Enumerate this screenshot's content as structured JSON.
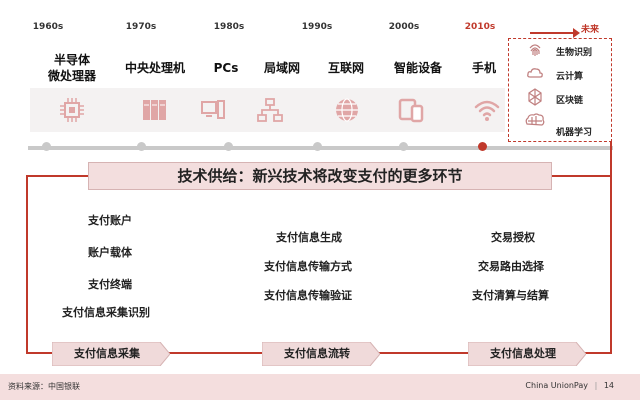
{
  "timeline": {
    "decades": [
      "1960s",
      "1970s",
      "1980s",
      "1990s",
      "2000s",
      "2010s",
      "未来"
    ],
    "technologies": [
      {
        "label_line1": "半导体",
        "label_line2": "微处理器",
        "icon": "chip-icon"
      },
      {
        "label_line1": "中央处理机",
        "label_line2": "",
        "icon": "server-icon"
      },
      {
        "label_line1": "PCs",
        "label_line2": "",
        "icon": "pc-icon"
      },
      {
        "label_line1": "局域网",
        "label_line2": "",
        "icon": "network-icon"
      },
      {
        "label_line1": "互联网",
        "label_line2": "",
        "icon": "globe-icon"
      },
      {
        "label_line1": "智能设备",
        "label_line2": "",
        "icon": "devices-icon"
      },
      {
        "label_line1": "手机",
        "label_line2": "",
        "icon": "wifi-icon"
      }
    ],
    "future": [
      {
        "label": "生物识别",
        "icon": "fingerprint-icon"
      },
      {
        "label": "云计算",
        "icon": "cloud-icon"
      },
      {
        "label": "区块链",
        "icon": "blockchain-icon"
      },
      {
        "label": "机器学习",
        "icon": "brain-icon"
      }
    ],
    "colors": {
      "accent": "#c0392b",
      "line": "#c9c9c9"
    }
  },
  "banner": {
    "title": "技术供给：新兴技术将改变支付的更多环节"
  },
  "columns": [
    {
      "items": [
        "支付账户",
        "账户载体",
        "支付终端",
        "支付信息采集识别"
      ],
      "stage": "支付信息采集"
    },
    {
      "items": [
        "支付信息生成",
        "支付信息传输方式",
        "支付信息传输验证"
      ],
      "stage": "支付信息流转"
    },
    {
      "items": [
        "交易授权",
        "交易路由选择",
        "支付清算与结算"
      ],
      "stage": "支付信息处理"
    }
  ],
  "footer": {
    "source": "资料来源：中国银联",
    "brand": "China UnionPay",
    "page": "14"
  }
}
